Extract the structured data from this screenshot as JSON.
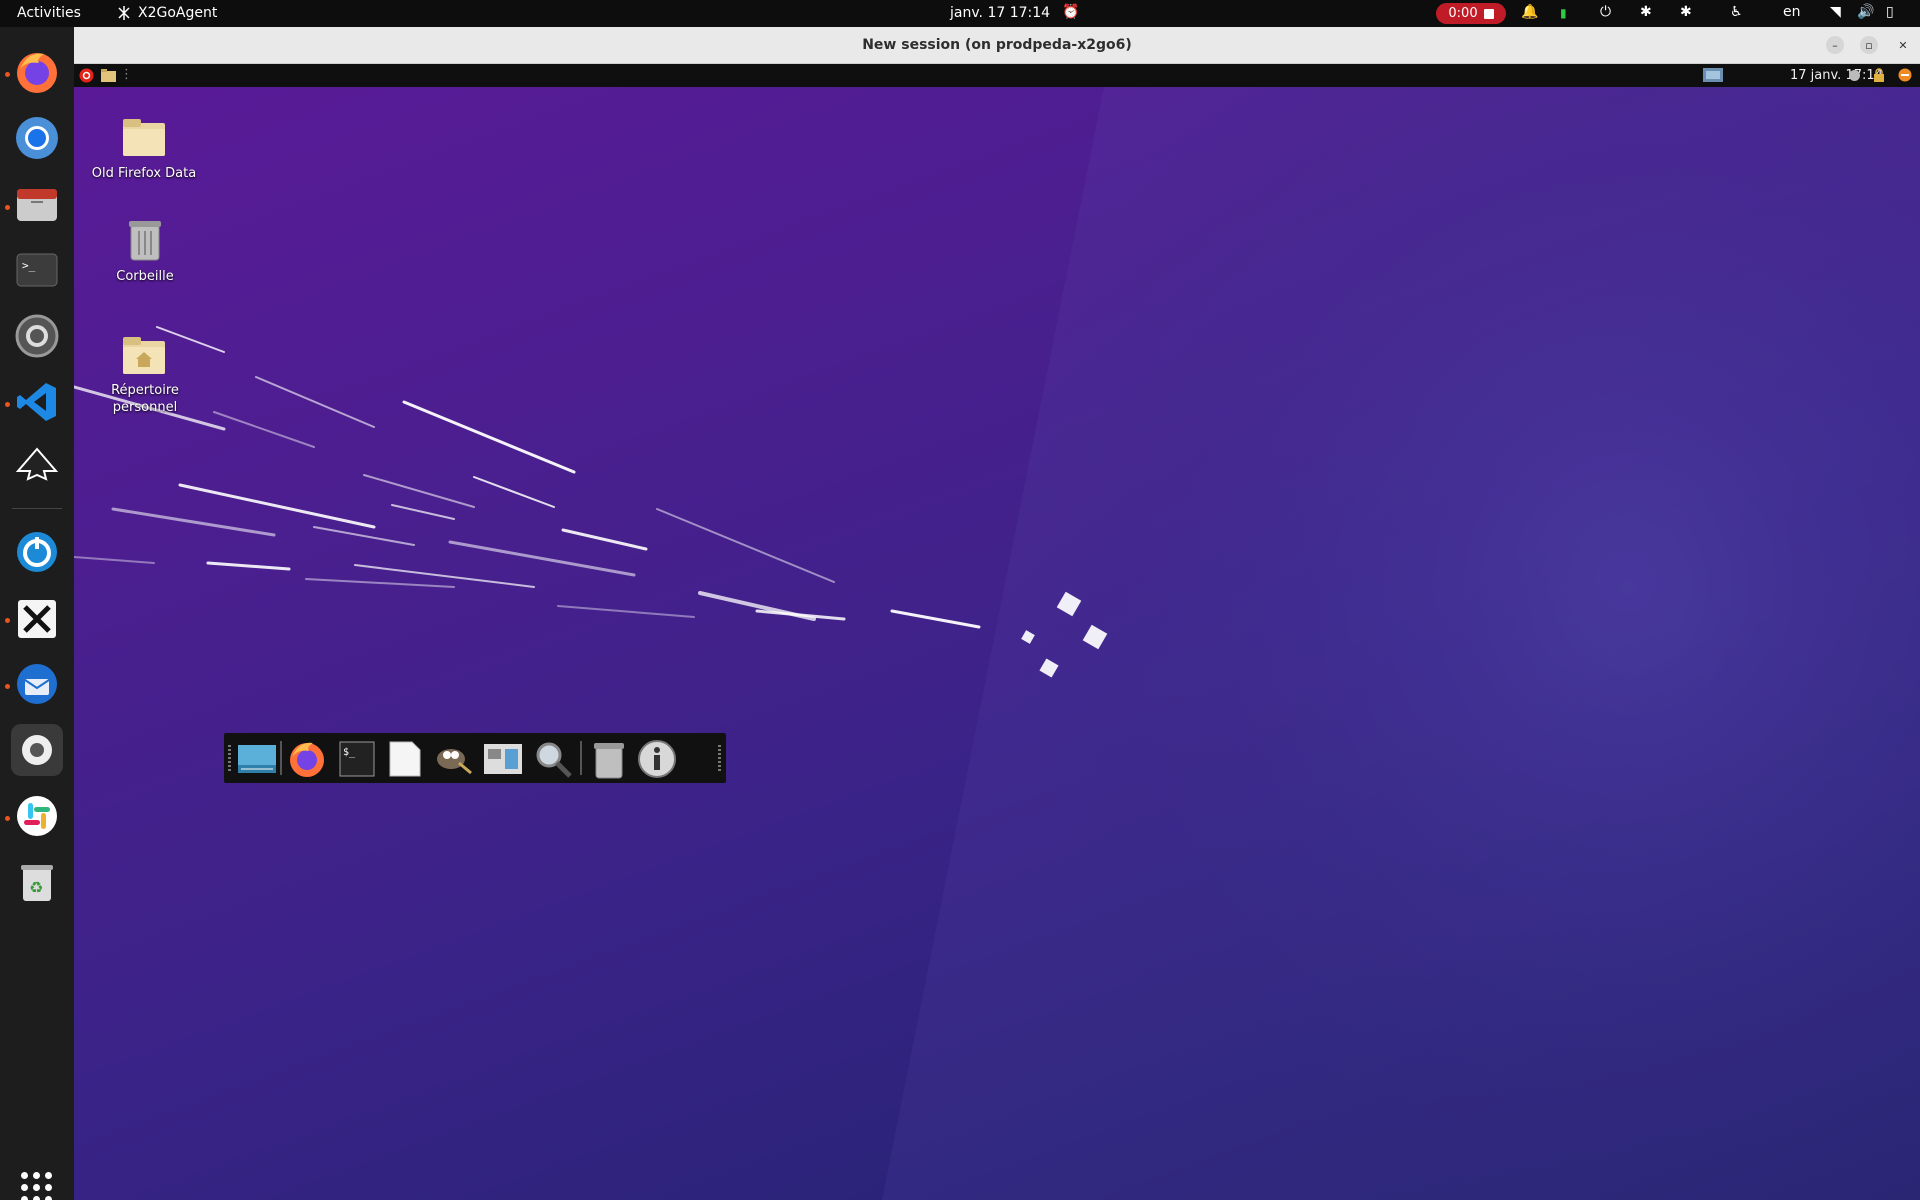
{
  "topbar": {
    "activities": "Activities",
    "app_name": "X2GoAgent",
    "clock": "janv. 17  17:14",
    "recording": "0:00",
    "language": "en"
  },
  "dock": {
    "items": [
      "firefox-icon",
      "chromium-icon",
      "files-icon",
      "terminal-icon",
      "settings-icon",
      "vscode-icon",
      "inkscape-icon",
      "x2go-icon",
      "xmind-icon",
      "thunderbird-icon",
      "gnome-settings-icon",
      "slack-icon",
      "trash-icon"
    ]
  },
  "window": {
    "title": "New session (on prodpeda-x2go6)",
    "inner_datetime": "17 janv. 17:14"
  },
  "desktop": {
    "icons": [
      {
        "label": "Old Firefox Data"
      },
      {
        "label": "Corbeille"
      },
      {
        "label": "Répertoire personnel"
      }
    ]
  },
  "launcher": {
    "items": [
      "desktop-icon",
      "firefox-icon",
      "terminal-icon",
      "text-editor-icon",
      "gimp-icon",
      "workspace-icon",
      "search-icon",
      "trash-icon",
      "info-icon"
    ]
  },
  "colors": {
    "accent": "#e95420",
    "record": "#c01c28",
    "wallpaper": "#4a1f8f"
  }
}
